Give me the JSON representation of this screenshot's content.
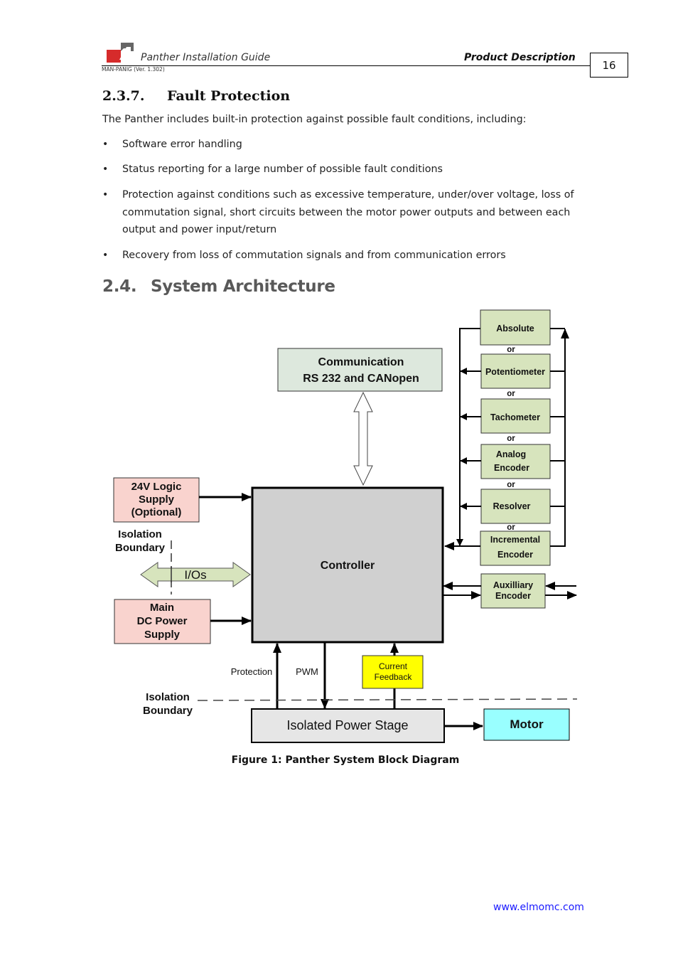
{
  "header": {
    "doc_title": "Panther Installation Guide",
    "section_name": "Product Description",
    "doc_id": "MAN-PANIG (Ver. 1.302)",
    "page_number": "16",
    "logo_icon": "elmo-logo-icon"
  },
  "section_237": {
    "number": "2.3.7.",
    "title": "Fault Protection",
    "intro": "The Panther includes built-in protection against possible fault conditions, including:",
    "bullets": [
      "Software error handling",
      "Status reporting for a large number of possible fault conditions",
      "Protection against conditions such as excessive temperature, under/over voltage, loss of commutation signal, short circuits between the motor power outputs and between each output and power input/return",
      "Recovery from loss of commutation signals and from communication errors"
    ],
    "bullet3_lines": [
      "Protection against conditions such as excessive temperature, under/over voltage, loss of",
      "commutation signal, short circuits between the motor power outputs and between each",
      "output and power input/return"
    ]
  },
  "section_24": {
    "number": "2.4.",
    "title": "System Architecture"
  },
  "diagram": {
    "communication": [
      "Communication",
      "RS 232 and CANopen"
    ],
    "controller": "Controller",
    "logic_supply": [
      "24V Logic",
      "Supply",
      "(Optional)"
    ],
    "main_supply": [
      "Main",
      "DC Power",
      "Supply"
    ],
    "ios": "I/Os",
    "isolation_boundary": [
      "Isolation",
      "Boundary"
    ],
    "feedback_devices": [
      [
        "Absolute"
      ],
      [
        "Potentiometer"
      ],
      [
        "Tachometer"
      ],
      [
        "Analog",
        "Encoder"
      ],
      [
        "Resolver"
      ],
      [
        "Incremental",
        "Encoder"
      ]
    ],
    "or_label": "or",
    "auxiliary": [
      "Auxilliary",
      "Encoder"
    ],
    "protection": "Protection",
    "pwm": "PWM",
    "current_feedback": [
      "Current",
      "Feedback"
    ],
    "power_stage": "Isolated Power Stage",
    "motor": "Motor",
    "colors": {
      "feedback_fill": "#d7e4bd",
      "supply_fill": "#f9d3ce",
      "comm_fill": "#dde8dd",
      "controller_fill": "#d0d0d0",
      "power_stage_fill": "#e6e6e6",
      "motor_fill": "#99ffff",
      "current_feedback_fill": "#ffff00",
      "ios_fill": "#d7e4bd"
    }
  },
  "caption": "Figure 1: Panther System Block Diagram",
  "footer": {
    "website": "www.elmomc.com"
  }
}
